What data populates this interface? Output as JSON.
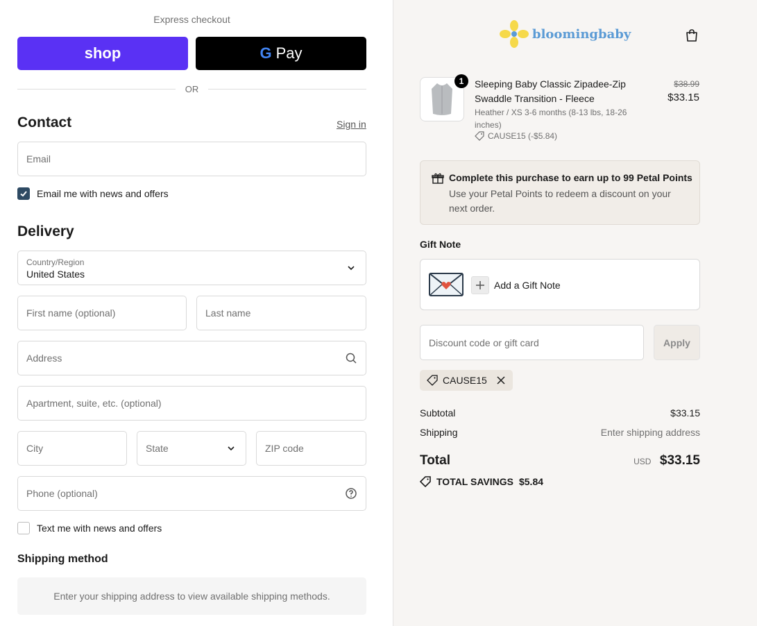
{
  "express": {
    "label": "Express checkout",
    "shop_label": "shop",
    "gpay_g": "G",
    "gpay_label": "Pay",
    "or_label": "OR"
  },
  "contact": {
    "title": "Contact",
    "sign_in": "Sign in",
    "email_placeholder": "Email",
    "news_checkbox_label": "Email me with news and offers",
    "news_checked": true
  },
  "delivery": {
    "title": "Delivery",
    "country_label": "Country/Region",
    "country_value": "United States",
    "first_name_placeholder": "First name (optional)",
    "last_name_placeholder": "Last name",
    "address_placeholder": "Address",
    "apartment_placeholder": "Apartment, suite, etc. (optional)",
    "city_placeholder": "City",
    "state_placeholder": "State",
    "zip_placeholder": "ZIP code",
    "phone_placeholder": "Phone (optional)",
    "text_checkbox_label": "Text me with news and offers",
    "text_checked": false
  },
  "shipping_method": {
    "title": "Shipping method",
    "message": "Enter your shipping address to view available shipping methods."
  },
  "brand": {
    "name_part1": "blooming",
    "name_part2": "baby"
  },
  "cart": {
    "item": {
      "quantity": "1",
      "name": "Sleeping Baby Classic Zipadee-Zip Swaddle Transition - Fleece",
      "variant": "Heather / XS 3-6 months (8-13 lbs, 18-26 inches)",
      "discount": "CAUSE15 (-$5.84)",
      "original_price": "$38.99",
      "price": "$33.15"
    },
    "petal": {
      "title": "Complete this purchase to earn up to 99 Petal Points",
      "body": "Use your Petal Points to redeem a discount on your next order."
    },
    "gift_note": {
      "title": "Gift Note",
      "add_label": "Add a Gift Note"
    },
    "discount": {
      "placeholder": "Discount code or gift card",
      "apply_label": "Apply",
      "applied_code": "CAUSE15"
    },
    "summary": {
      "subtotal_label": "Subtotal",
      "subtotal_value": "$33.15",
      "shipping_label": "Shipping",
      "shipping_value": "Enter shipping address",
      "total_label": "Total",
      "currency": "USD",
      "total_value": "$33.15",
      "savings_label": "TOTAL SAVINGS",
      "savings_value": "$5.84"
    }
  },
  "colors": {
    "shop_purple": "#5a31f4",
    "checkbox_blue": "#2e4a63",
    "sidebar_bg": "#f7f5f3",
    "brand_blue": "#5b9bd5",
    "brand_yellow": "#f6d94a"
  },
  "icons": [
    "search-icon",
    "help-icon",
    "chevron-down-icon",
    "bag-icon",
    "gift-icon",
    "tag-icon",
    "envelope-icon",
    "plus-icon",
    "close-icon",
    "check-icon",
    "flower-logo-icon"
  ]
}
